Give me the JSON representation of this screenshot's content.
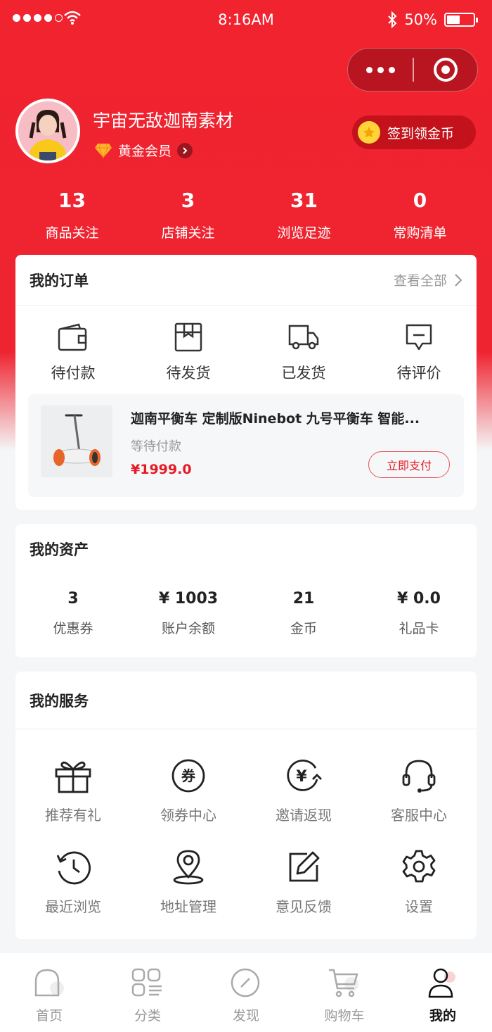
{
  "status_bar": {
    "time": "8:16AM",
    "battery": "50%",
    "battery_level": 0.5
  },
  "profile": {
    "username": "宇宙无敌迦南素材",
    "member_level": "黄金会员",
    "checkin_label": "签到领金币"
  },
  "stats": [
    {
      "value": "13",
      "label": "商品关注"
    },
    {
      "value": "3",
      "label": "店铺关注"
    },
    {
      "value": "31",
      "label": "浏览足迹"
    },
    {
      "value": "0",
      "label": "常购清单"
    }
  ],
  "orders": {
    "title": "我的订单",
    "view_all": "查看全部",
    "statuses": [
      {
        "label": "待付款",
        "icon": "wallet-icon"
      },
      {
        "label": "待发货",
        "icon": "package-icon"
      },
      {
        "label": "已发货",
        "icon": "truck-icon"
      },
      {
        "label": "待评价",
        "icon": "comment-icon"
      }
    ],
    "item": {
      "title": "迦南平衡车 定制版Ninebot 九号平衡车 智能...",
      "status": "等待付款",
      "price": "¥1999.0",
      "pay_label": "立即支付"
    }
  },
  "assets": {
    "title": "我的资产",
    "items": [
      {
        "value": "3",
        "label": "优惠券"
      },
      {
        "value": "¥ 1003",
        "label": "账户余额"
      },
      {
        "value": "21",
        "label": "金币"
      },
      {
        "value": "¥ 0.0",
        "label": "礼品卡"
      }
    ]
  },
  "services": {
    "title": "我的服务",
    "items": [
      {
        "label": "推荐有礼",
        "icon": "gift-icon"
      },
      {
        "label": "领券中心",
        "icon": "coupon-icon"
      },
      {
        "label": "邀请返现",
        "icon": "cashback-icon"
      },
      {
        "label": "客服中心",
        "icon": "headset-icon"
      },
      {
        "label": "最近浏览",
        "icon": "history-icon"
      },
      {
        "label": "地址管理",
        "icon": "location-icon"
      },
      {
        "label": "意见反馈",
        "icon": "feedback-icon"
      },
      {
        "label": "设置",
        "icon": "gear-icon"
      }
    ],
    "coupon_glyph": "券",
    "cashback_glyph": "¥"
  },
  "tabbar": [
    {
      "label": "首页",
      "icon": "home-icon"
    },
    {
      "label": "分类",
      "icon": "category-icon"
    },
    {
      "label": "发现",
      "icon": "discover-icon"
    },
    {
      "label": "购物车",
      "icon": "cart-icon"
    },
    {
      "label": "我的",
      "icon": "user-icon",
      "active": true
    }
  ],
  "colors": {
    "brand_red": "#ee2430",
    "price_red": "#e61a24",
    "gold": "#ffd43a"
  }
}
